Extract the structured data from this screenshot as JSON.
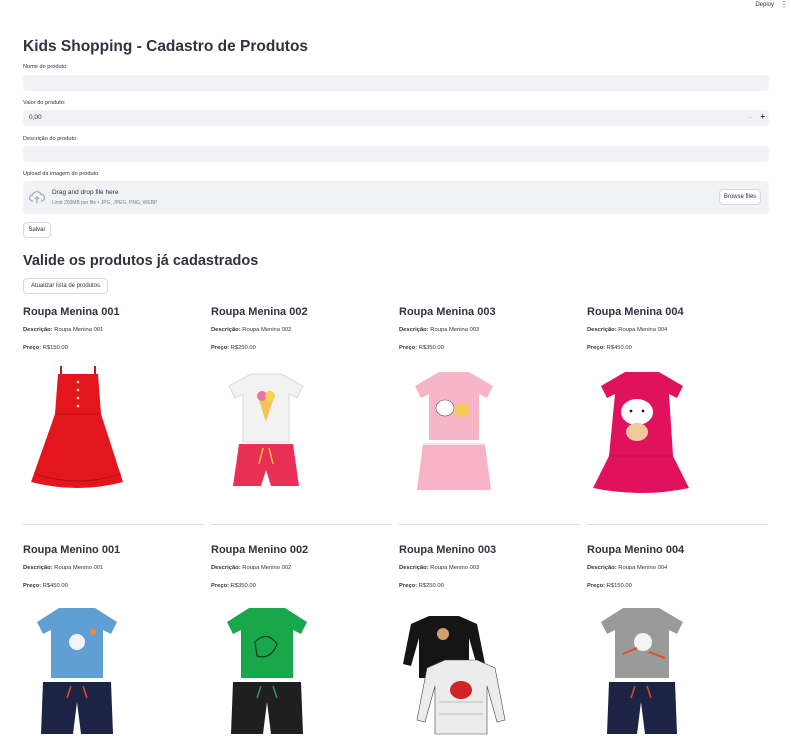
{
  "header": {
    "deploy_label": "Deploy",
    "menu_icon": "⋮"
  },
  "form": {
    "title": "Kids Shopping - Cadastro de Produtos",
    "name_label": "Nome do produto:",
    "name_value": "",
    "price_label": "Valor do produto:",
    "price_value": "0,00",
    "price_minus": "−",
    "price_plus": "+",
    "desc_label": "Descrição do produto:",
    "desc_value": "",
    "image_label": "Upload da imagem do produto",
    "drag_text": "Drag and drop file here",
    "limit_text": "Limit 200MB per file • JPG, JPEG, PNG, WEBP",
    "browse_label": "Browse files",
    "save_label": "Salvar"
  },
  "list": {
    "title": "Valide os produtos já cadastrados",
    "refresh_label": "Atualizar lista de produtos",
    "desc_prefix": "Descrição:",
    "price_prefix": "Preço:",
    "products": [
      {
        "name": "Roupa Menina 001",
        "description": "Roupa Menina 001",
        "price": "R$150.00",
        "image": "red-dress"
      },
      {
        "name": "Roupa Menina 002",
        "description": "Roupa Menina 002",
        "price": "R$250.00",
        "image": "white-shirt-red-shorts"
      },
      {
        "name": "Roupa Menina 003",
        "description": "Roupa Menina 003",
        "price": "R$350.00",
        "image": "pink-hello-kitty-set"
      },
      {
        "name": "Roupa Menina 004",
        "description": "Roupa Menina 004",
        "price": "R$450.00",
        "image": "magenta-hello-kitty-dress"
      },
      {
        "name": "Roupa Menino 001",
        "description": "Roupa Menino 001",
        "price": "R$450.00",
        "image": "blue-astronaut-set"
      },
      {
        "name": "Roupa Menino 002",
        "description": "Roupa Menino 002",
        "price": "R$350.00",
        "image": "green-shirt-black-shorts"
      },
      {
        "name": "Roupa Menino 003",
        "description": "Roupa Menino 003",
        "price": "R$250.00",
        "image": "black-long-sleeve-shirts"
      },
      {
        "name": "Roupa Menino 004",
        "description": "Roupa Menino 004",
        "price": "R$150.00",
        "image": "grey-astronaut-set"
      }
    ]
  }
}
